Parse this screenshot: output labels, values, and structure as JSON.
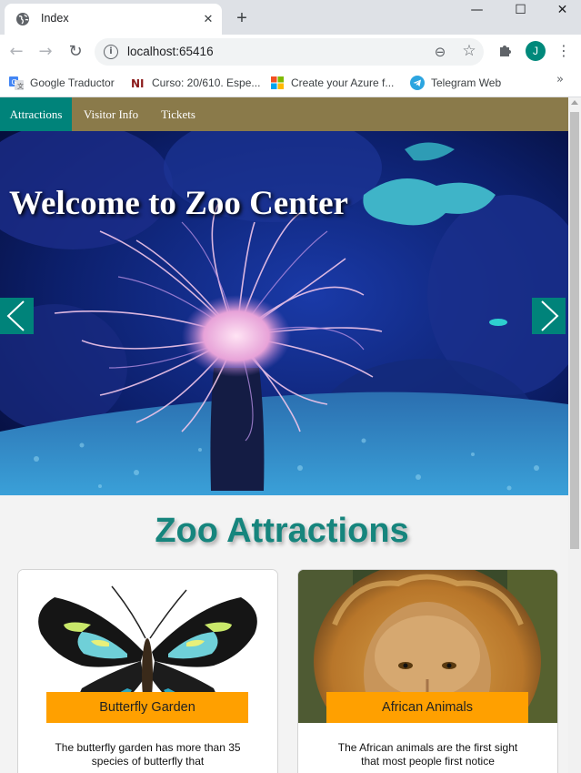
{
  "browser": {
    "tab_title": "Index",
    "url": "localhost:65416",
    "profile_initial": "J",
    "icons": {
      "back": "back-arrow-icon",
      "forward": "forward-arrow-icon",
      "reload": "reload-icon",
      "zoom": "zoom-icon",
      "bookmark_star": "star-icon",
      "extensions": "puzzle-icon",
      "menu": "kebab-menu-icon"
    },
    "bookmarks": [
      {
        "label": "Google Traductor"
      },
      {
        "label": "Curso: 20/610. Espe..."
      },
      {
        "label": "Create your Azure f..."
      },
      {
        "label": "Telegram Web"
      }
    ],
    "more_bookmarks": "»"
  },
  "site": {
    "nav": [
      {
        "label": "Attractions",
        "active": true
      },
      {
        "label": "Visitor Info",
        "active": false
      },
      {
        "label": "Tickets",
        "active": false
      }
    ],
    "hero_title": "Welcome to Zoo Center",
    "section_title": "Zoo Attractions",
    "cards": [
      {
        "label": "Butterfly Garden",
        "text": "The butterfly garden has more than 35 species of butterfly that"
      },
      {
        "label": "African Animals",
        "text": "The African animals are the first sight that most people first notice"
      }
    ]
  },
  "colors": {
    "nav_bar": "#8a7a4a",
    "accent_teal": "#00837a",
    "heading_teal": "#16857d",
    "card_label": "#ffa000"
  }
}
